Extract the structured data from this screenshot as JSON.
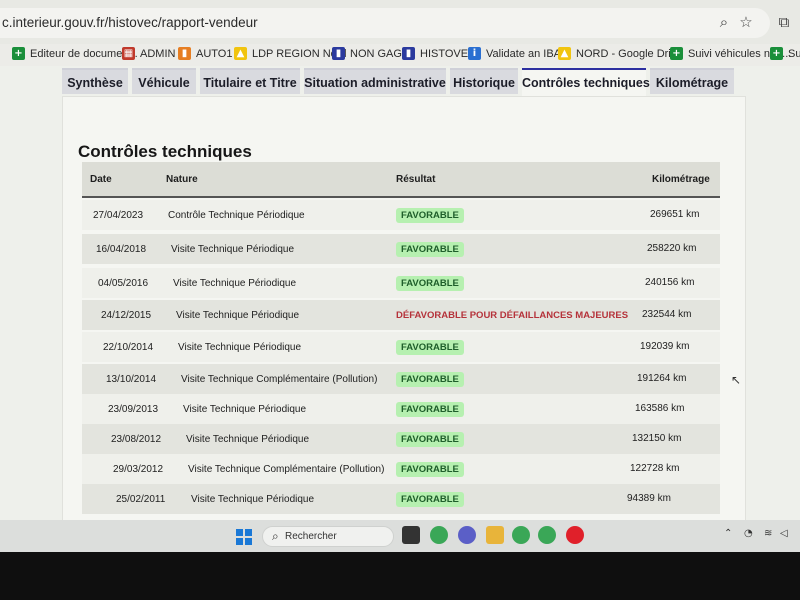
{
  "browser": {
    "url": "c.interieur.gouv.fr/histovec/rapport-vendeur",
    "bookmarks": [
      {
        "label": "Editeur de documen...",
        "icon": "plus-doc-icon",
        "color": "#1a8f3a"
      },
      {
        "label": "ADMIN",
        "icon": "grid-icon",
        "color": "#c0392b"
      },
      {
        "label": "AUTO1",
        "icon": "auto1-icon",
        "color": "#e67e22"
      },
      {
        "label": "LDP REGION Nord",
        "icon": "drive-icon",
        "color": "#f1c40f"
      },
      {
        "label": "NON GAGE",
        "icon": "flag-fr-icon",
        "color": "#2b3a9e"
      },
      {
        "label": "HISTOVEC",
        "icon": "flag-fr-icon",
        "color": "#2b3a9e"
      },
      {
        "label": "Validate an IBAN",
        "icon": "iban-icon",
        "color": "#2a6fd1"
      },
      {
        "label": "NORD - Google Drive",
        "icon": "drive-icon",
        "color": "#f1c40f"
      },
      {
        "label": "Suivi véhicules non...",
        "icon": "plus-doc-icon",
        "color": "#1a8f3a"
      },
      {
        "label": "Suiv",
        "icon": "plus-doc-icon",
        "color": "#1a8f3a"
      }
    ]
  },
  "tabs": [
    {
      "label": "Synthèse",
      "active": false
    },
    {
      "label": "Véhicule",
      "active": false
    },
    {
      "label": "Titulaire et Titre",
      "active": false
    },
    {
      "label": "Situation administrative",
      "active": false
    },
    {
      "label": "Historique",
      "active": false
    },
    {
      "label": "Contrôles techniques",
      "active": true
    },
    {
      "label": "Kilométrage",
      "active": false
    }
  ],
  "section_title": "Contrôles techniques",
  "table": {
    "headers": {
      "date": "Date",
      "nature": "Nature",
      "result": "Résultat",
      "km": "Kilométrage"
    },
    "rows": [
      {
        "date": "27/04/2023",
        "nature": "Contrôle Technique Périodique",
        "result": "FAVORABLE",
        "status": "ok",
        "km": "269651 km"
      },
      {
        "date": "16/04/2018",
        "nature": "Visite Technique Périodique",
        "result": "FAVORABLE",
        "status": "ok",
        "km": "258220 km"
      },
      {
        "date": "04/05/2016",
        "nature": "Visite Technique Périodique",
        "result": "FAVORABLE",
        "status": "ok",
        "km": "240156 km"
      },
      {
        "date": "24/12/2015",
        "nature": "Visite Technique Périodique",
        "result": "DÉFAVORABLE POUR DÉFAILLANCES MAJEURES",
        "status": "ko",
        "km": "232544 km"
      },
      {
        "date": "22/10/2014",
        "nature": "Visite Technique Périodique",
        "result": "FAVORABLE",
        "status": "ok",
        "km": "192039 km"
      },
      {
        "date": "13/10/2014",
        "nature": "Visite Technique Complémentaire (Pollution)",
        "result": "FAVORABLE",
        "status": "ok",
        "km": "191264 km"
      },
      {
        "date": "23/09/2013",
        "nature": "Visite Technique Périodique",
        "result": "FAVORABLE",
        "status": "ok",
        "km": "163586 km"
      },
      {
        "date": "23/08/2012",
        "nature": "Visite Technique Périodique",
        "result": "FAVORABLE",
        "status": "ok",
        "km": "132150 km"
      },
      {
        "date": "29/03/2012",
        "nature": "Visite Technique Complémentaire (Pollution)",
        "result": "FAVORABLE",
        "status": "ok",
        "km": "122728 km"
      },
      {
        "date": "25/02/2011",
        "nature": "Visite Technique Périodique",
        "result": "FAVORABLE",
        "status": "ok",
        "km": "94389 km"
      }
    ]
  },
  "taskbar": {
    "search_label": "Rechercher",
    "apps": [
      {
        "name": "file-explorer-dark-icon",
        "color": "#333333"
      },
      {
        "name": "chrome-icon",
        "color": "#3aa757"
      },
      {
        "name": "teams-icon",
        "color": "#5b5fc7"
      },
      {
        "name": "folder-icon",
        "color": "#e8b43a"
      },
      {
        "name": "chrome-icon",
        "color": "#3aa757"
      },
      {
        "name": "chrome-icon",
        "color": "#3aa757"
      },
      {
        "name": "opera-icon",
        "color": "#e0202a"
      }
    ]
  }
}
